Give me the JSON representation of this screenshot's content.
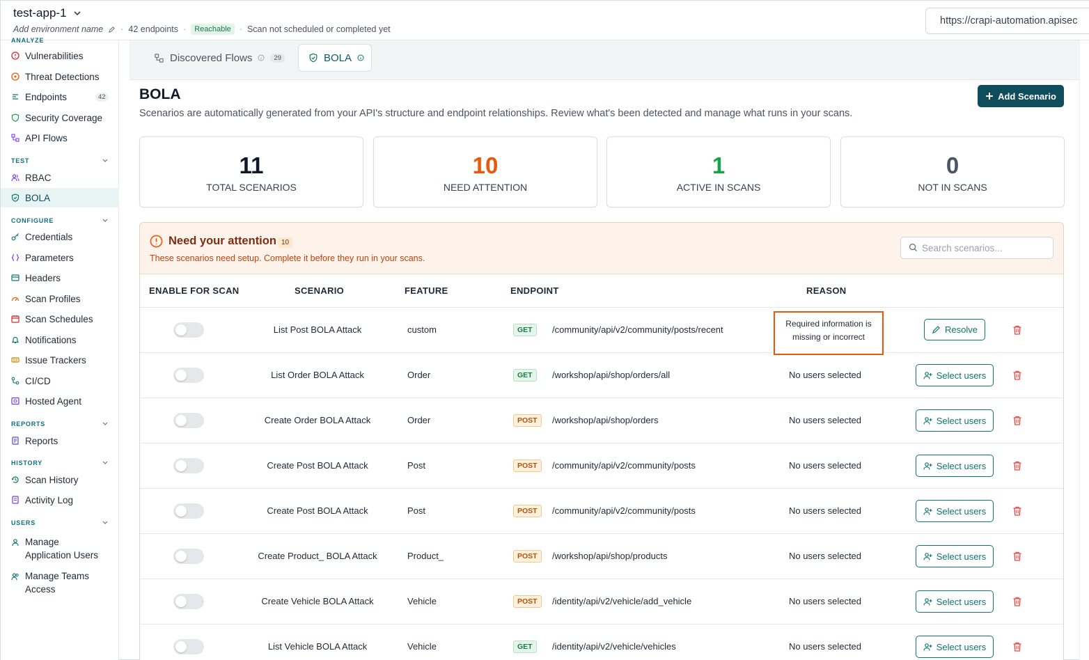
{
  "topbar": {
    "app_name": "test-app-1",
    "env_name": "Add environment name",
    "endpoints": "42 endpoints",
    "sep": "·",
    "status_badge": "Reachable",
    "scan_status": "Scan not scheduled or completed yet",
    "url": "https://crapi-automation.apisec"
  },
  "sidebar": {
    "cut_label": "ANALYZE",
    "analyze": [
      {
        "label": "Vulnerabilities",
        "icon": "shield-alert-icon"
      },
      {
        "label": "Threat Detections",
        "icon": "target-icon"
      },
      {
        "label": "Endpoints",
        "icon": "endpoints-icon",
        "count": "42"
      },
      {
        "label": "Security Coverage",
        "icon": "shield-icon"
      },
      {
        "label": "API Flows",
        "icon": "flow-icon"
      }
    ],
    "test_label": "TEST",
    "test": [
      {
        "label": "RBAC",
        "icon": "users-icon"
      },
      {
        "label": "BOLA",
        "icon": "shield-check-icon",
        "active": true
      }
    ],
    "configure_label": "CONFIGURE",
    "configure": [
      {
        "label": "Credentials",
        "icon": "key-icon"
      },
      {
        "label": "Parameters",
        "icon": "braces-icon"
      },
      {
        "label": "Headers",
        "icon": "headers-icon"
      },
      {
        "label": "Scan Profiles",
        "icon": "gauge-icon"
      },
      {
        "label": "Scan Schedules",
        "icon": "calendar-icon"
      },
      {
        "label": "Notifications",
        "icon": "bell-icon"
      },
      {
        "label": "Issue Trackers",
        "icon": "ticket-icon"
      },
      {
        "label": "CI/CD",
        "icon": "pipeline-icon"
      },
      {
        "label": "Hosted Agent",
        "icon": "agent-icon"
      }
    ],
    "reports_label": "REPORTS",
    "reports": [
      {
        "label": "Reports",
        "icon": "report-icon"
      }
    ],
    "history_label": "HISTORY",
    "history": [
      {
        "label": "Scan History",
        "icon": "history-icon"
      },
      {
        "label": "Activity Log",
        "icon": "log-icon"
      }
    ],
    "users_label": "USERS",
    "users": [
      {
        "label_1": "Manage",
        "label_2": "Application Users",
        "icon": "user-icon"
      },
      {
        "label_1": "Manage Teams",
        "label_2": "Access",
        "icon": "team-icon"
      }
    ]
  },
  "tabs": [
    {
      "label": "Discovered Flows",
      "count": "29",
      "icon": "flows-icon"
    },
    {
      "label": "BOLA",
      "icon": "shield-check-icon",
      "active": true
    }
  ],
  "page": {
    "title": "BOLA",
    "subtitle": "Scenarios are automatically generated from your API's structure and endpoint relationships. Review what's been detected and manage what runs in your scans.",
    "add_button": "Add Scenario"
  },
  "stats": [
    {
      "value": "11",
      "label": "TOTAL SCENARIOS",
      "color": "#111827"
    },
    {
      "value": "10",
      "label": "NEED ATTENTION",
      "color": "#ea580c"
    },
    {
      "value": "1",
      "label": "ACTIVE IN SCANS",
      "color": "#16a34a"
    },
    {
      "value": "0",
      "label": "NOT IN SCANS",
      "color": "#4b5563"
    }
  ],
  "attention": {
    "title": "Need your attention",
    "count": "10",
    "subtitle": "These scenarios need setup. Complete it before they run in your scans.",
    "search_placeholder": "Search scenarios..."
  },
  "table": {
    "headers": [
      "ENABLE FOR SCAN",
      "SCENARIO",
      "FEATURE",
      "ENDPOINT",
      "REASON"
    ],
    "rows": [
      {
        "scenario": "List Post BOLA Attack",
        "feature": "custom",
        "method": "GET",
        "endpoint": "/community/api/v2/community/posts/recent",
        "reason_1": "Required information is",
        "reason_2": "missing or incorrect",
        "action": "Resolve",
        "enabled": false
      },
      {
        "scenario": "List Order BOLA Attack",
        "feature": "Order",
        "method": "GET",
        "endpoint": "/workshop/api/shop/orders/all",
        "reason": "No users selected",
        "action": "Select users",
        "enabled": false
      },
      {
        "scenario": "Create Order BOLA Attack",
        "feature": "Order",
        "method": "POST",
        "endpoint": "/workshop/api/shop/orders",
        "reason": "No users selected",
        "action": "Select users",
        "enabled": false
      },
      {
        "scenario": "Create Post BOLA Attack",
        "feature": "Post",
        "method": "POST",
        "endpoint": "/community/api/v2/community/posts",
        "reason": "No users selected",
        "action": "Select users",
        "enabled": false
      },
      {
        "scenario": "Create Post BOLA Attack",
        "feature": "Post",
        "method": "POST",
        "endpoint": "/community/api/v2/community/posts",
        "reason": "No users selected",
        "action": "Select users",
        "enabled": false
      },
      {
        "scenario": "Create Product_ BOLA Attack",
        "feature": "Product_",
        "method": "POST",
        "endpoint": "/workshop/api/shop/products",
        "reason": "No users selected",
        "action": "Select users",
        "enabled": false
      },
      {
        "scenario": "Create Vehicle BOLA Attack",
        "feature": "Vehicle",
        "method": "POST",
        "endpoint": "/identity/api/v2/vehicle/add_vehicle",
        "reason": "No users selected",
        "action": "Select users",
        "enabled": false
      },
      {
        "scenario": "List Vehicle BOLA Attack",
        "feature": "Vehicle",
        "method": "GET",
        "endpoint": "/identity/api/v2/vehicle/vehicles",
        "reason": "No users selected",
        "action": "Select users",
        "enabled": false
      }
    ]
  }
}
